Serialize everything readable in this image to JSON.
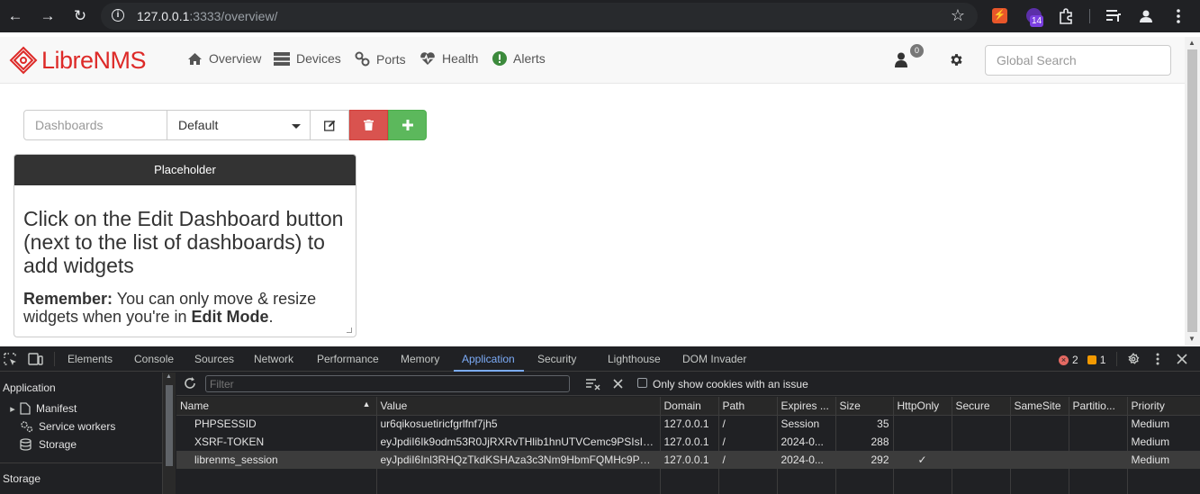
{
  "browser": {
    "url_host": "127.0.0.1",
    "url_rest": ":3333/overview/",
    "extension_badge": "14"
  },
  "nav": {
    "logo_libre": "Libre",
    "logo_nms": "NMS",
    "items": [
      {
        "label": "Overview",
        "icon": "home-icon"
      },
      {
        "label": "Devices",
        "icon": "server-icon"
      },
      {
        "label": "Ports",
        "icon": "link-icon"
      },
      {
        "label": "Health",
        "icon": "heartbeat-icon"
      },
      {
        "label": "Alerts",
        "icon": "alert-icon"
      }
    ],
    "user_badge": "0",
    "search_placeholder": "Global Search"
  },
  "dashboard": {
    "label": "Dashboards",
    "selected": "Default"
  },
  "widget": {
    "title": "Placeholder",
    "heading": "Click on the Edit Dashboard button (next to the list of dashboards) to add widgets",
    "remember_bold": "Remember:",
    "remember_text": " You can only move & resize widgets when you're in ",
    "edit_mode": "Edit Mode",
    "period": "."
  },
  "devtools": {
    "tabs": [
      "Elements",
      "Console",
      "Sources",
      "Network",
      "Performance",
      "Memory",
      "Application",
      "Security",
      "Lighthouse",
      "DOM Invader"
    ],
    "active_tab": "Application",
    "errors": "2",
    "warnings": "1",
    "sidebar": {
      "title": "Application",
      "items": [
        "Manifest",
        "Service workers",
        "Storage"
      ],
      "storage_header": "Storage"
    },
    "filter_placeholder": "Filter",
    "only_issues_label": "Only show cookies with an issue",
    "columns": [
      "Name",
      "Value",
      "Domain",
      "Path",
      "Expires ...",
      "Size",
      "HttpOnly",
      "Secure",
      "SameSite",
      "Partitio...",
      "Priority"
    ],
    "rows": [
      {
        "name": "PHPSESSID",
        "value": "ur6qikosuetiricfgrlfnf7jh5",
        "domain": "127.0.0.1",
        "path": "/",
        "expires": "Session",
        "size": "35",
        "httponly": "",
        "secure": "",
        "samesite": "",
        "partition": "",
        "priority": "Medium"
      },
      {
        "name": "XSRF-TOKEN",
        "value": "eyJpdiI6Ik9odm53R0JjRXRvTHlib1hnUTVCemc9PSIsIn...",
        "domain": "127.0.0.1",
        "path": "/",
        "expires": "2024-0...",
        "size": "288",
        "httponly": "",
        "secure": "",
        "samesite": "",
        "partition": "",
        "priority": "Medium"
      },
      {
        "name": "librenms_session",
        "value": "eyJpdiI6Inl3RHQzTkdKSHAza3c3Nm9HbmFQMHc9PSI...",
        "domain": "127.0.0.1",
        "path": "/",
        "expires": "2024-0...",
        "size": "292",
        "httponly": "✓",
        "secure": "",
        "samesite": "",
        "partition": "",
        "priority": "Medium"
      }
    ]
  },
  "colors": {
    "brand_red": "#dd2a28",
    "danger": "#d9534f",
    "success": "#5cb85c",
    "devtools_accent": "#7cacf8"
  }
}
